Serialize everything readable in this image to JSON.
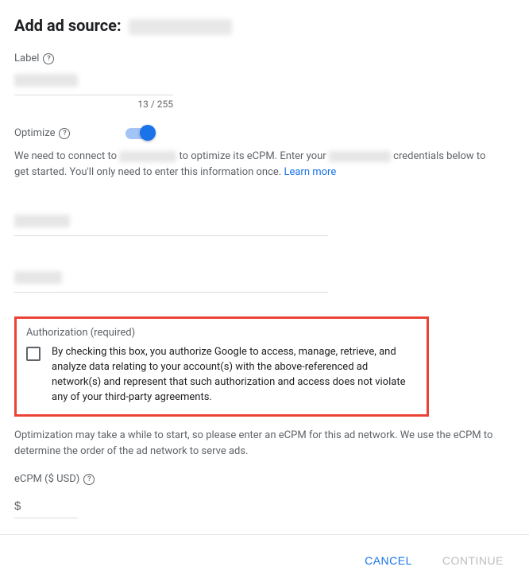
{
  "title_prefix": "Add ad source:",
  "label": {
    "text": "Label",
    "char_count": "13 / 255"
  },
  "optimize": {
    "text": "Optimize",
    "description_1": "We need to connect to ",
    "description_2": " to optimize its eCPM. Enter your ",
    "description_3": " credentials below to get started. You'll only need to enter this information once. ",
    "learn_more": "Learn more"
  },
  "authorization": {
    "heading": "Authorization (required)",
    "text": "By checking this box, you authorize Google to access, manage, retrieve, and analyze data relating to your account(s) with the above-referenced ad network(s) and represent that such authorization and access does not violate any of your third-party agreements."
  },
  "post_auth_note": "Optimization may take a while to start, so please enter an eCPM for this ad network. We use the eCPM to determine the order of the ad network to serve ads.",
  "ecpm": {
    "label": "eCPM ($ USD)",
    "prefix": "$"
  },
  "buttons": {
    "cancel": "CANCEL",
    "continue": "CONTINUE"
  }
}
